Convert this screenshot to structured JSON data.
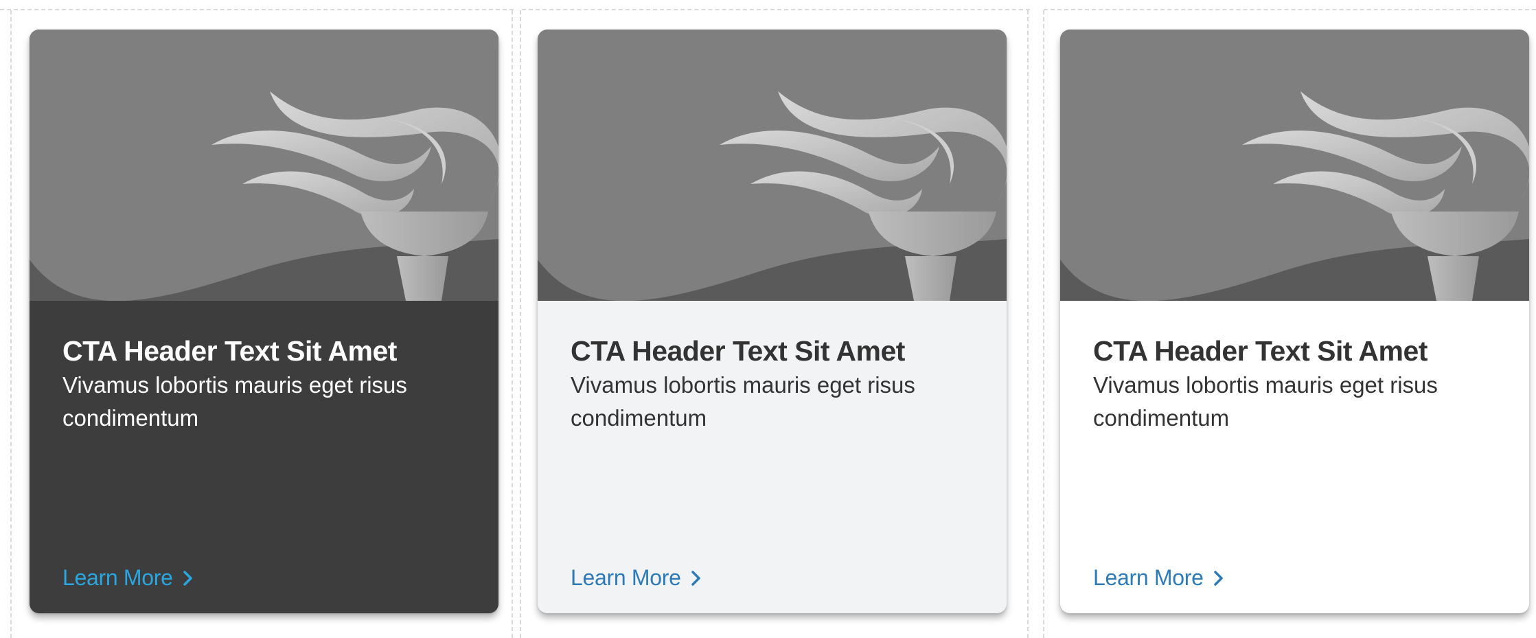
{
  "colors": {
    "dark_card_bg": "#3d3d3d",
    "light_card_bg": "#f2f3f4",
    "white_card_bg": "#ffffff",
    "link_blue_dark": "#2aa6e0",
    "link_blue": "#2c7bb8",
    "image_top": "#7f7f7f",
    "image_hill": "#5a5a5a"
  },
  "cards": [
    {
      "theme": "dark",
      "title": "CTA Header Text Sit Amet",
      "text": "Vivamus lobortis mauris eget risus condimentum",
      "link": "Learn More",
      "image_icon": "torch-flame-icon"
    },
    {
      "theme": "light",
      "title": "CTA Header Text Sit Amet",
      "text": "Vivamus lobortis mauris eget risus condimentum",
      "link": "Learn More",
      "image_icon": "torch-flame-icon"
    },
    {
      "theme": "white",
      "title": "CTA Header Text Sit Amet",
      "text": "Vivamus lobortis mauris eget risus condimentum",
      "link": "Learn More",
      "image_icon": "torch-flame-icon"
    }
  ]
}
